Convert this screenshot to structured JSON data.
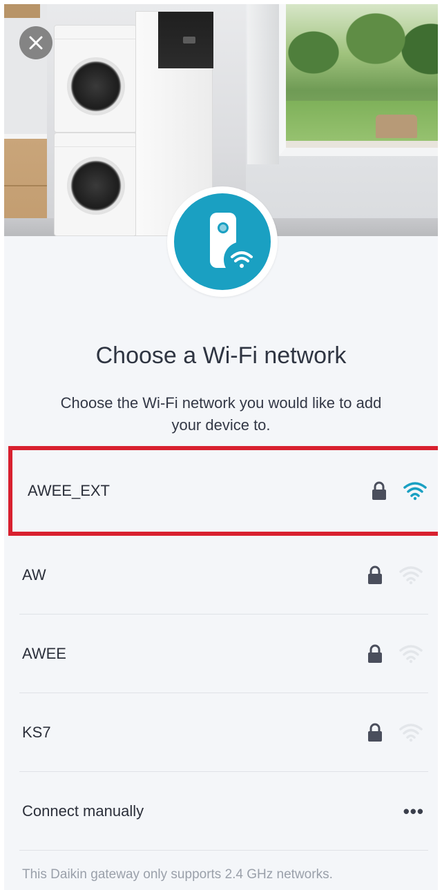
{
  "header": {
    "close_icon": "close-icon"
  },
  "device": {
    "icon": "gateway-wifi-icon",
    "accent_color": "#1aa0c2"
  },
  "title": "Choose a Wi-Fi network",
  "subtitle": "Choose the Wi-Fi network you would like to add your device to.",
  "networks": [
    {
      "name": "AWEE_EXT",
      "secured": true,
      "signal": "strong",
      "selected": true
    },
    {
      "name": "AW",
      "secured": true,
      "signal": "weak",
      "selected": false
    },
    {
      "name": "AWEE",
      "secured": true,
      "signal": "weak",
      "selected": false
    },
    {
      "name": "KS7",
      "secured": true,
      "signal": "weak",
      "selected": false
    }
  ],
  "manual": {
    "label": "Connect manually",
    "more": "•••"
  },
  "footnote": "This Daikin gateway only supports 2.4 GHz networks.",
  "colors": {
    "selection_border": "#d8202f",
    "wifi_strong": "#1aa0c2",
    "wifi_weak": "#e3e6ea",
    "lock": "#4a4e5c"
  }
}
